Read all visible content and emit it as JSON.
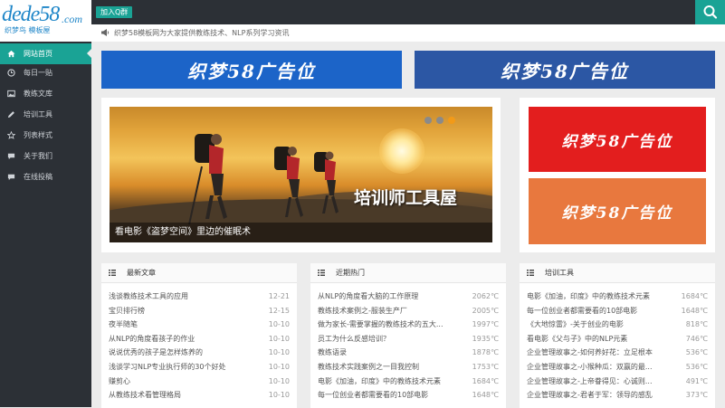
{
  "header": {
    "logo_text": "dede58",
    "logo_suffix": ".com",
    "logo_sub": "织梦鸟 模板屋",
    "qq_button": "加入Q群",
    "search_icon": "search-icon"
  },
  "notice": {
    "icon": "megaphone-icon",
    "text": "织梦58模板网为大家提供教练技术、NLP系列学习资讯"
  },
  "sidebar": {
    "items": [
      {
        "label": "网站首页",
        "icon": "home-icon",
        "active": true
      },
      {
        "label": "每日一贴",
        "icon": "clock-icon"
      },
      {
        "label": "教练文库",
        "icon": "image-icon"
      },
      {
        "label": "培训工具",
        "icon": "pencil-icon"
      },
      {
        "label": "列表样式",
        "icon": "star-icon"
      },
      {
        "label": "关于我们",
        "icon": "chat-icon"
      },
      {
        "label": "在线投稿",
        "icon": "chat-icon"
      }
    ]
  },
  "ads": {
    "top_left": "织梦58广告位",
    "top_right": "织梦58广告位",
    "side_red": "织梦58广告位",
    "side_orange": "织梦58广告位"
  },
  "slider": {
    "caption": "看电影《盗梦空间》里边的催眠术",
    "brand": "培训师工具屋",
    "dots": 3,
    "active_dot": 3
  },
  "panels": {
    "latest": {
      "title": "最新文章",
      "items": [
        {
          "title": "浅谈教练技术工具的应用",
          "value": "12-21"
        },
        {
          "title": "宝贝排行榜",
          "value": "12-15"
        },
        {
          "title": "夜半随笔",
          "value": "10-10"
        },
        {
          "title": "从NLP的角度看孩子的作业",
          "value": "10-10"
        },
        {
          "title": "说说优秀的孩子是怎样炼养的",
          "value": "10-10"
        },
        {
          "title": "浅谈学习NLP专业执行师的30个好处",
          "value": "10-10"
        },
        {
          "title": "赚剪心",
          "value": "10-10"
        },
        {
          "title": "从教练技术看管理格局",
          "value": "10-10"
        }
      ]
    },
    "hot": {
      "title": "近期热门",
      "items": [
        {
          "title": "从NLP的角度看大脑的工作原理",
          "value": "2062℃"
        },
        {
          "title": "教练技术案例之-服装生产厂",
          "value": "2005℃"
        },
        {
          "title": "做为家长-需要掌握的教练技术的五大...",
          "value": "1997℃"
        },
        {
          "title": "员工为什么反感培训？",
          "value": "1935℃"
        },
        {
          "title": "教练语录",
          "value": "1878℃"
        },
        {
          "title": "教练技术实践案例之一目我控制",
          "value": "1753℃"
        },
        {
          "title": "电影《加油，印度》中的教练技术元素",
          "value": "1684℃"
        },
        {
          "title": "每一位创业者都需要看的10部电影",
          "value": "1648℃"
        }
      ]
    },
    "tools": {
      "title": "培训工具",
      "items": [
        {
          "title": "电影《加油，印度》中的教练技术元素",
          "value": "1684℃"
        },
        {
          "title": "每一位创业者都需要看的10部电影",
          "value": "1648℃"
        },
        {
          "title": "《大地惊雷》-关于创业的电影",
          "value": "818℃"
        },
        {
          "title": "看电影《父与子》中的NLP元素",
          "value": "746℃"
        },
        {
          "title": "企业管理故事之-如何养好花：立足根本",
          "value": "536℃"
        },
        {
          "title": "企业管理故事之-小猴种瓜：双赢的最...",
          "value": "536℃"
        },
        {
          "title": "企业管理故事之-上帝眷得见：心诚则...",
          "value": "491℃"
        },
        {
          "title": "企业管理故事之-君者于军：领导的感乱",
          "value": "373℃"
        }
      ]
    }
  }
}
